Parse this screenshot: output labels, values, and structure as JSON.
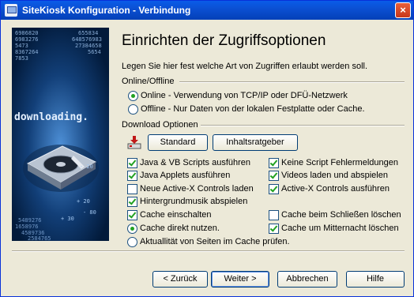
{
  "window": {
    "title": "SiteKiosk Konfiguration - Verbindung",
    "close_label": "×"
  },
  "page": {
    "heading": "Einrichten der Zugriffsoptionen",
    "intro": "Legen Sie hier fest welche Art von Zugriffen erlaubt werden soll."
  },
  "online_offline": {
    "label": "Online/Offline",
    "option_online": "Online - Verwendung von TCP/IP oder DFÜ-Netzwerk",
    "option_offline": "Offline - Nur Daten von der lokalen Festplatte oder Cache.",
    "selected": "online"
  },
  "download": {
    "label": "Download Optionen",
    "standard_button": "Standard",
    "content_advisor_button": "Inhaltsratgeber",
    "left_options": [
      {
        "label": "Java & VB Scripts ausführen",
        "checked": true
      },
      {
        "label": "Java Applets ausführen",
        "checked": true
      },
      {
        "label": "Neue Active-X Controls laden",
        "checked": false
      },
      {
        "label": "Hintergrundmusik abspielen",
        "checked": true
      },
      {
        "label": "Cache einschalten",
        "checked": true
      }
    ],
    "right_options": [
      {
        "label": "Keine Script Fehlermeldungen",
        "checked": true
      },
      {
        "label": "Videos laden und abspielen",
        "checked": true
      },
      {
        "label": "Active-X Controls ausführen",
        "checked": true
      },
      {
        "label": "Cache beim Schließen löschen",
        "checked": false
      },
      {
        "label": "Cache um Mitternacht löschen",
        "checked": true
      }
    ],
    "cache_direct": "Cache direkt nutzen.",
    "cache_check": "Aktuallität von Seiten im Cache prüfen.",
    "cache_mode": "direct"
  },
  "sidebar_art": {
    "word": "downloading.",
    "numbers_top": [
      "6986820",
      "6983276",
      "5473",
      "8367264",
      "7853"
    ],
    "numbers_right": [
      "655834",
      "648576983",
      "27384658",
      "5654"
    ],
    "scale": [
      "- 20",
      "+ 20",
      "- 80",
      "+ 30"
    ],
    "numbers_bottom": [
      "5489276",
      "1658976",
      "4589736",
      "2584765"
    ]
  },
  "footer": {
    "back_label": "< Zurück",
    "next_label": "Weiter >",
    "cancel_label": "Abbrechen",
    "help_label": "Hilfe"
  }
}
